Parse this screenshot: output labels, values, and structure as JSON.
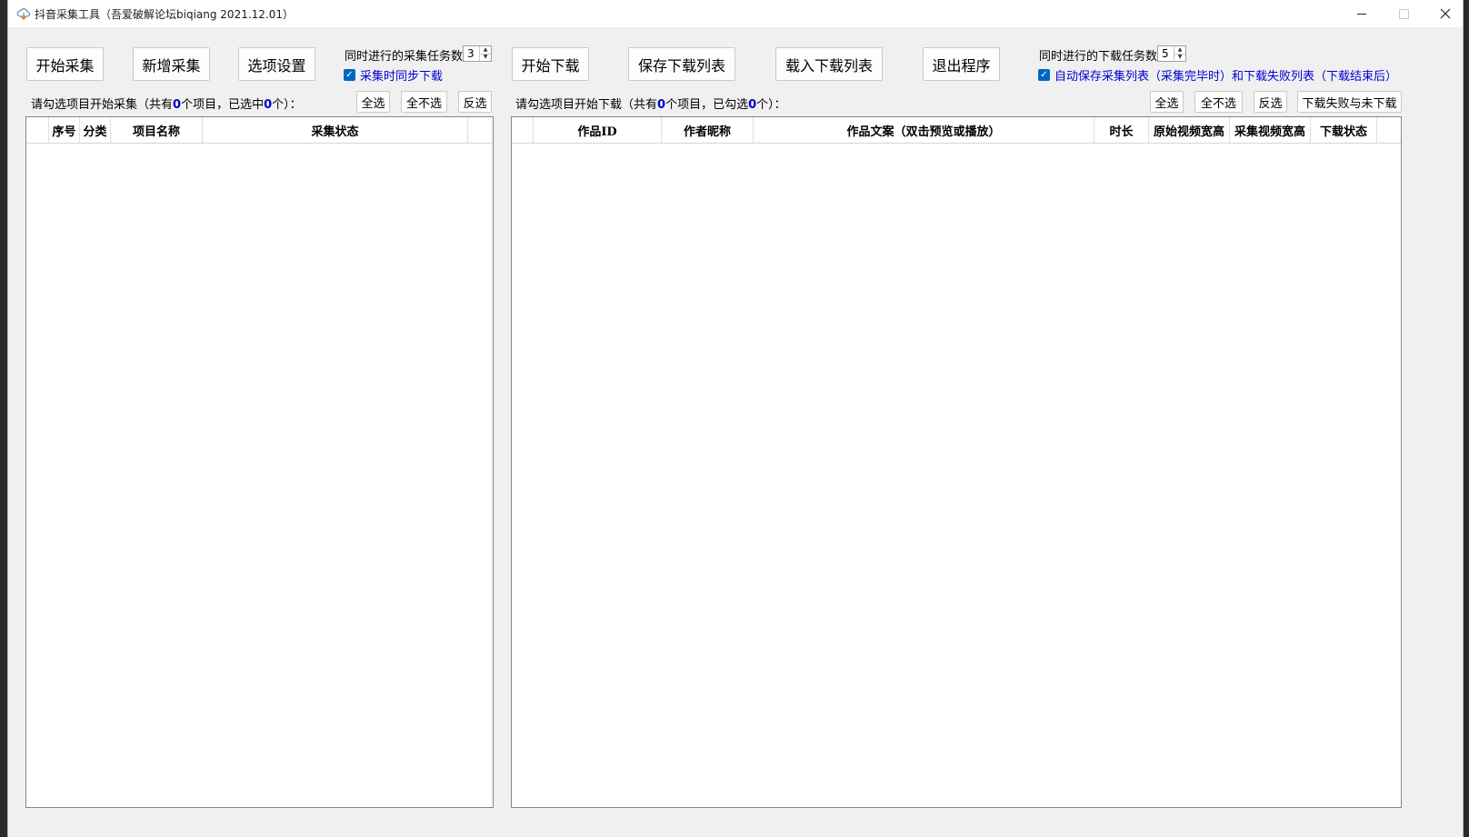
{
  "window": {
    "title": "抖音采集工具（吾爱破解论坛biqiang 2021.12.01）",
    "controls": {
      "minimize": "—",
      "maximize": "□",
      "close": "✕"
    }
  },
  "left": {
    "buttons": {
      "start_collect": "开始采集",
      "new_collect": "新增采集",
      "options": "选项设置"
    },
    "concurrent_label": "同时进行的采集任务数",
    "concurrent_value": "3",
    "sync_download_label": "采集时同步下载",
    "status": {
      "prefix": "请勾选项目开始采集（共有",
      "total": "0",
      "middle": "个项目，已选中",
      "selected": "0",
      "suffix": "个）："
    },
    "select_buttons": {
      "all": "全选",
      "none": "全不选",
      "invert": "反选"
    },
    "columns": [
      "",
      "序号",
      "分类",
      "项目名称",
      "采集状态",
      ""
    ]
  },
  "right": {
    "buttons": {
      "start_download": "开始下载",
      "save_list": "保存下载列表",
      "load_list": "载入下载列表",
      "exit": "退出程序"
    },
    "concurrent_label": "同时进行的下载任务数",
    "concurrent_value": "5",
    "autosave_label": "自动保存采集列表（采集完毕时）和下载失败列表（下载结束后）",
    "status": {
      "prefix": "请勾选项目开始下载（共有",
      "total": "0",
      "middle": "个项目，已勾选",
      "selected": "0",
      "suffix": "个）："
    },
    "select_buttons": {
      "all": "全选",
      "none": "全不选",
      "invert": "反选",
      "failed_and_pending": "下载失败与未下载"
    },
    "columns": [
      "",
      "作品ID",
      "作者昵称",
      "作品文案（双击预览或播放）",
      "时长",
      "原始视频宽高",
      "采集视频宽高",
      "下载状态",
      ""
    ]
  },
  "icons": {
    "app": "cloud-download-icon",
    "checkbox": "check-icon",
    "spin_up": "▲",
    "spin_down": "▼"
  }
}
